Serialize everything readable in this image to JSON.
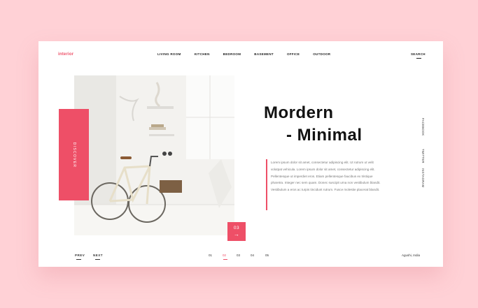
{
  "header": {
    "logo": "interior",
    "nav": [
      "LIVING ROOM",
      "KITCHEN",
      "BEDROOM",
      "BASEMENT",
      "OFFICE",
      "OUTDOOR"
    ],
    "search": "SEARCH"
  },
  "hero": {
    "discover": "DISCOVER",
    "title_line1": "Mordern",
    "title_line2": "- Minimal",
    "paragraph": "Lorem ipsum dolor sit amet, consectetur adipiscing elit. Ut rutrum ut velit volutpat vehicula. Lorem ipsum dolor sit amet, consectetur adipiscing elit. Pellentesque ut imperdiet eros. Etiam pellentesque faucibus ex tristique pharetra. Integer nec sem quam. Donec suscipit urna non vestibulum blandit. Vestibulum a eros ac turpis tincidunt rutrum. Fusce molestie placerat blandit.",
    "slide_number": "03",
    "slide_arrow": "→"
  },
  "social": [
    "FACEBOOK",
    "TWITTER",
    "INSTAGRAM"
  ],
  "footer": {
    "prev": "PREV",
    "next": "NEXT",
    "pages": [
      "01",
      "02",
      "03",
      "04",
      "05"
    ],
    "active_page": "02",
    "location": "Agushi, India"
  },
  "colors": {
    "accent": "#ee4f67",
    "background": "#ffd1d6"
  }
}
